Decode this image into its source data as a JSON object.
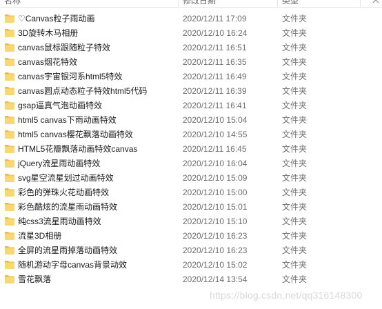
{
  "header": {
    "name_label": "名称",
    "date_label": "修改日期",
    "type_label": "类型"
  },
  "rows": [
    {
      "name": "♡Canvas粒子雨动画",
      "date": "2020/12/11 17:09",
      "type": "文件夹"
    },
    {
      "name": "3D旋转木马相册",
      "date": "2020/12/10 16:24",
      "type": "文件夹"
    },
    {
      "name": "canvas鼠标跟随粒子特效",
      "date": "2020/12/11 16:51",
      "type": "文件夹"
    },
    {
      "name": "canvas烟花特效",
      "date": "2020/12/11 16:35",
      "type": "文件夹"
    },
    {
      "name": "canvas宇宙银河系html5特效",
      "date": "2020/12/11 16:49",
      "type": "文件夹"
    },
    {
      "name": "canvas圆点动态粒子特效html5代码",
      "date": "2020/12/11 16:39",
      "type": "文件夹"
    },
    {
      "name": "gsap逼真气泡动画特效",
      "date": "2020/12/11 16:41",
      "type": "文件夹"
    },
    {
      "name": "html5 canvas下雨动画特效",
      "date": "2020/12/10 15:04",
      "type": "文件夹"
    },
    {
      "name": "html5 canvas樱花飘落动画特效",
      "date": "2020/12/10 14:55",
      "type": "文件夹"
    },
    {
      "name": "HTML5花瓣飘落动画特效canvas",
      "date": "2020/12/11 16:45",
      "type": "文件夹"
    },
    {
      "name": "jQuery流星雨动画特效",
      "date": "2020/12/10 16:04",
      "type": "文件夹"
    },
    {
      "name": "svg星空流星划过动画特效",
      "date": "2020/12/10 15:09",
      "type": "文件夹"
    },
    {
      "name": "彩色的弹珠火花动画特效",
      "date": "2020/12/10 15:00",
      "type": "文件夹"
    },
    {
      "name": "彩色酷炫的流星雨动画特效",
      "date": "2020/12/10 15:01",
      "type": "文件夹"
    },
    {
      "name": "纯css3流星雨动画特效",
      "date": "2020/12/10 15:10",
      "type": "文件夹"
    },
    {
      "name": "流星3D相册",
      "date": "2020/12/10 16:23",
      "type": "文件夹"
    },
    {
      "name": "全屏的流星雨掉落动画特效",
      "date": "2020/12/10 16:23",
      "type": "文件夹"
    },
    {
      "name": "随机游动字母canvas背景动效",
      "date": "2020/12/10 15:02",
      "type": "文件夹"
    },
    {
      "name": "雪花飘落",
      "date": "2020/12/14 13:54",
      "type": "文件夹"
    }
  ],
  "watermark": "https://blog.csdn.net/qq316148300",
  "colors": {
    "folder_body": "#f8d775",
    "folder_tab": "#e9b949",
    "hover": "#e5f3ff"
  },
  "icons": {
    "folder": "folder-icon",
    "sort": "chevron-up-icon"
  }
}
